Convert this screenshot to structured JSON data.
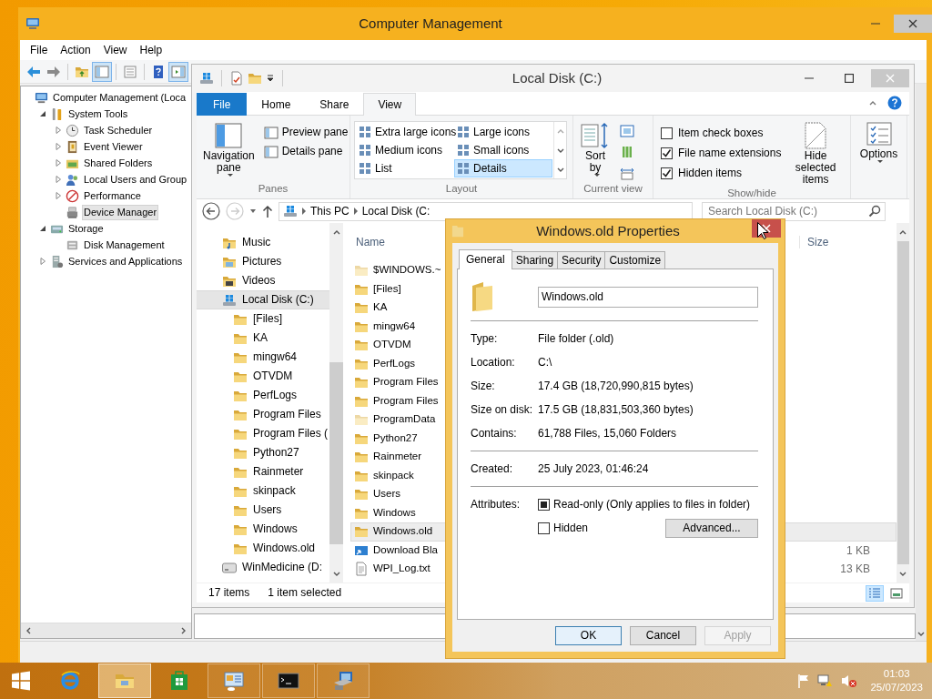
{
  "computer_management": {
    "title": "Computer Management",
    "menu": [
      "File",
      "Action",
      "View",
      "Help"
    ],
    "tree": [
      {
        "label": "Computer Management (Loca",
        "selected": false,
        "children": [
          {
            "label": "System Tools",
            "expanded": true,
            "selected": false,
            "children": [
              {
                "label": "Task Scheduler",
                "expanded": false,
                "selected": false
              },
              {
                "label": "Event Viewer",
                "expanded": false,
                "selected": false
              },
              {
                "label": "Shared Folders",
                "expanded": false,
                "selected": false
              },
              {
                "label": "Local Users and Group",
                "expanded": false,
                "selected": false
              },
              {
                "label": "Performance",
                "expanded": false,
                "selected": false
              },
              {
                "label": "Device Manager",
                "selected": true
              }
            ]
          },
          {
            "label": "Storage",
            "expanded": true,
            "selected": false,
            "children": [
              {
                "label": "Disk Management",
                "selected": false
              }
            ]
          },
          {
            "label": "Services and Applications",
            "expanded": false,
            "selected": false
          }
        ]
      }
    ]
  },
  "explorer": {
    "title": "Local Disk (C:)",
    "ribbon": {
      "tabs": [
        {
          "label": "File",
          "kind": "file",
          "selected": false
        },
        {
          "label": "Home",
          "kind": "tab",
          "selected": false
        },
        {
          "label": "Share",
          "kind": "tab",
          "selected": false
        },
        {
          "label": "View",
          "kind": "tab",
          "selected": true
        }
      ],
      "panes": {
        "label": "Panes",
        "navigation": "Navigation pane",
        "buttons": [
          "Preview pane",
          "Details pane"
        ]
      },
      "layout": {
        "label": "Layout",
        "options": [
          {
            "label": "Extra large icons",
            "selected": false
          },
          {
            "label": "Large icons",
            "selected": false
          },
          {
            "label": "Medium icons",
            "selected": false
          },
          {
            "label": "Small icons",
            "selected": false
          },
          {
            "label": "List",
            "selected": false
          },
          {
            "label": "Details",
            "selected": true
          }
        ]
      },
      "current_view": {
        "label": "Current view",
        "sort": "Sort by"
      },
      "show_hide": {
        "label": "Show/hide",
        "checkboxes": [
          {
            "label": "Item check boxes",
            "checked": false
          },
          {
            "label": "File name extensions",
            "checked": true
          },
          {
            "label": "Hidden items",
            "checked": true
          }
        ],
        "hide_button": "Hide selected items"
      },
      "options": "Options"
    },
    "address": [
      "This PC",
      "Local Disk (C:"
    ],
    "search": {
      "placeholder": "Search Local Disk (C:)"
    },
    "navigation": [
      {
        "label": "Music",
        "kind": "music",
        "selected": false
      },
      {
        "label": "Pictures",
        "kind": "pictures",
        "selected": false
      },
      {
        "label": "Videos",
        "kind": "videos",
        "selected": false
      },
      {
        "label": "Local Disk (C:)",
        "kind": "drive",
        "selected": true,
        "children": [
          {
            "label": "[Files]",
            "kind": "folder",
            "selected": false
          },
          {
            "label": "KA",
            "kind": "folder",
            "selected": false
          },
          {
            "label": "mingw64",
            "kind": "folder",
            "selected": false
          },
          {
            "label": "OTVDM",
            "kind": "folder",
            "selected": false
          },
          {
            "label": "PerfLogs",
            "kind": "folder",
            "selected": false
          },
          {
            "label": "Program Files",
            "kind": "folder",
            "selected": false
          },
          {
            "label": "Program Files (",
            "kind": "folder",
            "selected": false
          },
          {
            "label": "Python27",
            "kind": "folder",
            "selected": false
          },
          {
            "label": "Rainmeter",
            "kind": "folder",
            "selected": false
          },
          {
            "label": "skinpack",
            "kind": "folder",
            "selected": false
          },
          {
            "label": "Users",
            "kind": "folder",
            "selected": false
          },
          {
            "label": "Windows",
            "kind": "folder",
            "selected": false
          },
          {
            "label": "Windows.old",
            "kind": "folder",
            "selected": false
          }
        ]
      },
      {
        "label": "WinMedicine (D:",
        "kind": "removable",
        "selected": false
      }
    ],
    "columns": [
      "Name",
      "Size"
    ],
    "files": [
      {
        "name": "$WINDOWS.~",
        "kind": "folder",
        "hidden": true,
        "selected": false
      },
      {
        "name": "[Files]",
        "kind": "folder",
        "hidden": false,
        "selected": false
      },
      {
        "name": "KA",
        "kind": "folder",
        "hidden": false,
        "selected": false
      },
      {
        "name": "mingw64",
        "kind": "folder",
        "hidden": false,
        "selected": false
      },
      {
        "name": "OTVDM",
        "kind": "folder",
        "hidden": false,
        "selected": false
      },
      {
        "name": "PerfLogs",
        "kind": "folder",
        "hidden": false,
        "selected": false
      },
      {
        "name": "Program Files",
        "kind": "folder",
        "hidden": false,
        "selected": false
      },
      {
        "name": "Program Files",
        "kind": "folder",
        "hidden": false,
        "selected": false
      },
      {
        "name": "ProgramData",
        "kind": "folder",
        "hidden": true,
        "selected": false
      },
      {
        "name": "Python27",
        "kind": "folder",
        "hidden": false,
        "selected": false
      },
      {
        "name": "Rainmeter",
        "kind": "folder",
        "hidden": false,
        "selected": false
      },
      {
        "name": "skinpack",
        "kind": "folder",
        "hidden": false,
        "selected": false
      },
      {
        "name": "Users",
        "kind": "folder",
        "hidden": false,
        "selected": false
      },
      {
        "name": "Windows",
        "kind": "folder",
        "hidden": false,
        "selected": false
      },
      {
        "name": "Windows.old",
        "kind": "folder",
        "hidden": false,
        "selected": true
      },
      {
        "name": "Download Bla",
        "kind": "shortcut",
        "hidden": false,
        "selected": false,
        "size": "1 KB"
      },
      {
        "name": "WPI_Log.txt",
        "kind": "text",
        "hidden": false,
        "selected": false,
        "size": "13 KB"
      }
    ],
    "status": {
      "items": "17 items",
      "selection": "1 item selected",
      "view_buttons": [
        {
          "kind": "details",
          "selected": true
        },
        {
          "kind": "thumbnails",
          "selected": false
        }
      ]
    }
  },
  "properties_dialog": {
    "title": "Windows.old Properties",
    "tabs": [
      {
        "label": "General",
        "selected": true
      },
      {
        "label": "Sharing",
        "selected": false
      },
      {
        "label": "Security",
        "selected": false
      },
      {
        "label": "Customize",
        "selected": false
      }
    ],
    "name": "Windows.old",
    "sections": [
      [
        {
          "label": "Type:",
          "value": "File folder (.old)"
        },
        {
          "label": "Location:",
          "value": "C:\\"
        },
        {
          "label": "Size:",
          "value": "17.4 GB (18,720,990,815 bytes)"
        },
        {
          "label": "Size on disk:",
          "value": "17.5 GB (18,831,503,360 bytes)"
        },
        {
          "label": "Contains:",
          "value": "61,788 Files, 15,060 Folders"
        }
      ],
      [
        {
          "label": "Created:",
          "value": "25 July 2023, 01:46:24"
        }
      ]
    ],
    "attributes": {
      "label": "Attributes:",
      "options": [
        {
          "label": "Read-only (Only applies to files in folder)",
          "checked": false,
          "indeterminate": true
        },
        {
          "label": "Hidden",
          "checked": false,
          "indeterminate": false
        }
      ],
      "advanced": "Advanced..."
    },
    "buttons": [
      {
        "label": "OK",
        "default": true,
        "disabled": false
      },
      {
        "label": "Cancel",
        "default": false,
        "disabled": false
      },
      {
        "label": "Apply",
        "default": false,
        "disabled": true
      }
    ]
  },
  "taskbar": {
    "apps": [
      {
        "kind": "browser",
        "running": false,
        "active": false
      },
      {
        "kind": "explorer",
        "running": true,
        "active": true
      },
      {
        "kind": "store",
        "running": false,
        "active": false
      },
      {
        "kind": "management",
        "running": true,
        "active": false
      },
      {
        "kind": "terminal",
        "running": true,
        "active": false
      },
      {
        "kind": "network",
        "running": true,
        "active": false
      }
    ],
    "time": "01:03",
    "date": "25/07/2023"
  }
}
